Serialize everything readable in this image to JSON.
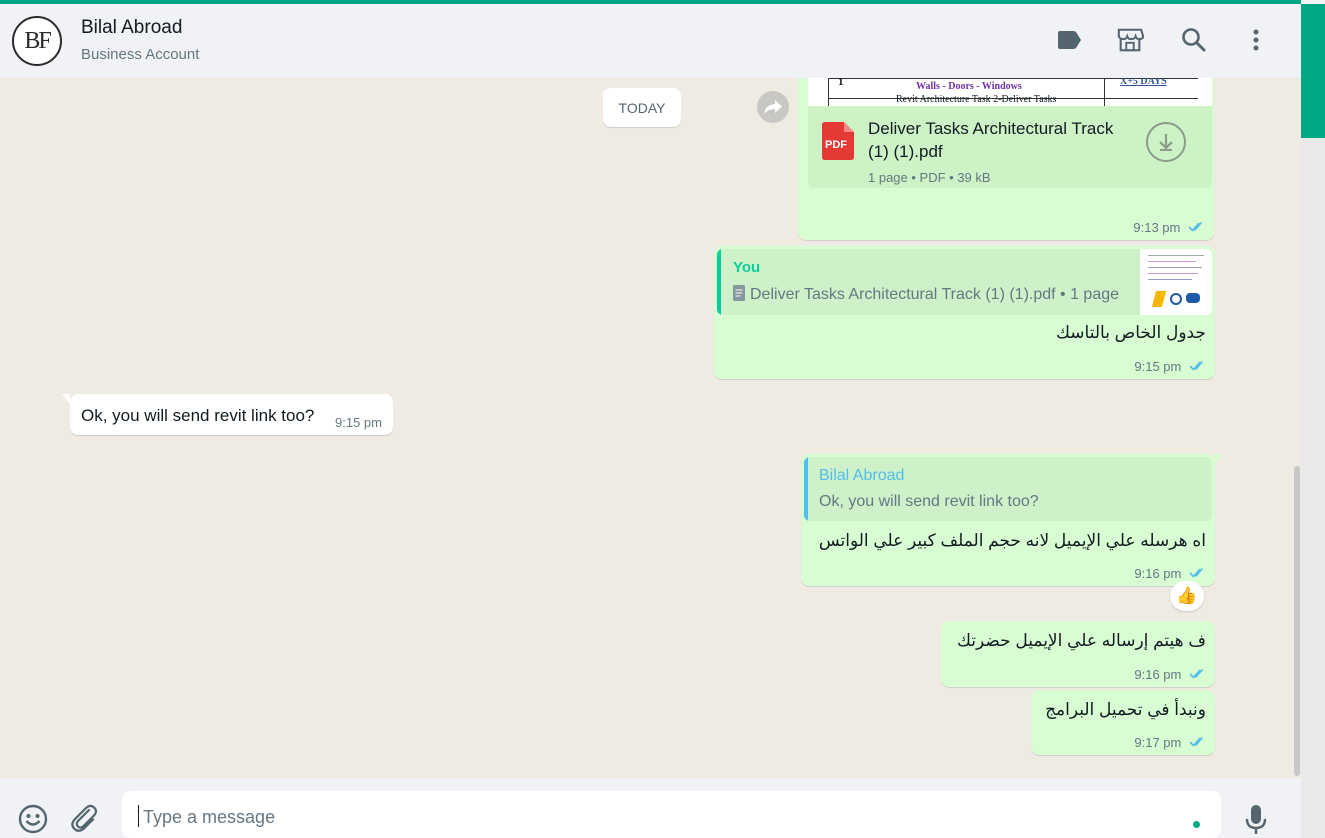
{
  "header": {
    "avatar_initials": "BF",
    "name": "Bilal Abroad",
    "subtitle": "Business Account",
    "icons": [
      "label-icon",
      "catalog-icon",
      "search-icon",
      "menu-icon"
    ]
  },
  "date_divider": "TODAY",
  "messages": {
    "document": {
      "preview_lines": [
        "Walls - Doors - Windows",
        "Revit Architecture Task 2-Deliver Tasks"
      ],
      "preview_cell_left": "1",
      "preview_cell_right": "X+5 DAYS",
      "file_icon_label": "PDF",
      "file_name_line1": "Deliver Tasks Architectural Track",
      "file_name_line2": "(1) (1).pdf",
      "file_meta": "1 page • PDF • 39 kB",
      "time": "9:13 pm"
    },
    "reply_to_doc": {
      "quote_author": "You",
      "quote_text": "Deliver Tasks Architectural Track (1) (1).pdf • 1 page",
      "text": "جدول الخاص بالتاسك",
      "time": "9:15 pm"
    },
    "incoming": {
      "text": "Ok, you will send revit link too?",
      "time": "9:15 pm"
    },
    "reply_to_question": {
      "quote_author": "Bilal Abroad",
      "quote_text": "Ok, you will send revit link too?",
      "text": "اه هرسله علي الإيميل لانه حجم الملف كبير علي الواتس",
      "time": "9:16 pm",
      "reaction": "👍"
    },
    "msg_email": {
      "text": "ف هيتم إرساله علي الإيميل حضرتك",
      "time": "9:16 pm"
    },
    "msg_download": {
      "text": "ونبدأ في تحميل البرامج",
      "time": "9:17 pm"
    }
  },
  "composer": {
    "placeholder": "Type a message",
    "icons": [
      "emoji-icon",
      "attach-icon",
      "mic-icon"
    ]
  },
  "colors": {
    "accent": "#00a884",
    "outgoing_bubble": "#d9fdd3",
    "incoming_bubble": "#ffffff",
    "read_ticks": "#53bdeb"
  }
}
